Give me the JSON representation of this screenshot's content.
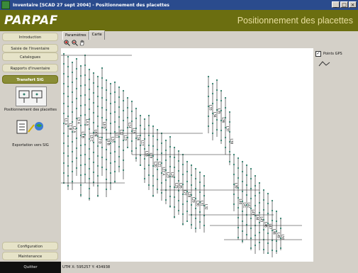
{
  "window": {
    "title": "Inventaire [SCAD 27 sept 2004] - Positionnement des placettes",
    "buttons": {
      "minimize": "_",
      "maximize": "□",
      "close": "×"
    }
  },
  "header": {
    "logo": "PARPAF",
    "page_title": "Positionnement des placettes"
  },
  "sidebar": {
    "items": [
      {
        "label": "Introduction"
      },
      {
        "label": "Saisie de l'Inventaire"
      },
      {
        "label": "Catalogues"
      },
      {
        "label": "Rapports d'inventaire"
      },
      {
        "label": "Transfert SIG",
        "active": true
      }
    ],
    "group_items": [
      {
        "label": "Positionnement des placettes"
      },
      {
        "label": "Exportation vers SIG"
      }
    ],
    "bottom_items": [
      {
        "label": "Configuration"
      },
      {
        "label": "Maintenance"
      }
    ],
    "quit": "Quitter"
  },
  "content": {
    "tabs": [
      {
        "label": "Paramètres"
      },
      {
        "label": "Carte",
        "active": true
      }
    ],
    "tools": [
      "zoom-in",
      "zoom-out",
      "pan"
    ],
    "legend": {
      "label": "Points GPS",
      "checked": true
    }
  },
  "status": {
    "coords": "UTM X: 595257   Y: 434938"
  },
  "map": {
    "labels": [
      "L1 A",
      "L1 B",
      "L2 A",
      "L3 A",
      "L3 B",
      "L4 A",
      "L5 C",
      "L6 N",
      "L7 D",
      "L8 D",
      "L9 B",
      "L10",
      "L11",
      "L12",
      "L13",
      "L14",
      "L15",
      "L16",
      "L17",
      "L18",
      "L19",
      "L20",
      "L21",
      "L22 A",
      "L23",
      "L24",
      "L25",
      "L26",
      "L27",
      "L28",
      "L29",
      "L30",
      "L31",
      "L32",
      "L33",
      "L34",
      "L35",
      "L36",
      "L37",
      "L38",
      "L39",
      "L40",
      "L41",
      "L42",
      "L43",
      "L44",
      "L45",
      "L46",
      "L47",
      "L48",
      "L49",
      "L50"
    ],
    "colors": {
      "point": "#2e7d6a",
      "line": "#1a1a1a"
    }
  }
}
